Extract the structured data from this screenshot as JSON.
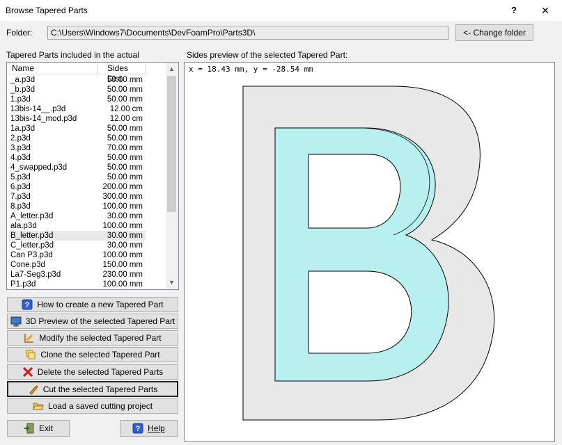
{
  "window": {
    "title": "Browse Tapered Parts",
    "help_glyph": "?",
    "close_glyph": "✕"
  },
  "folder": {
    "label": "Folder:",
    "path": "C:\\Users\\Windows7\\Documents\\DevFoamPro\\Parts3D\\",
    "change_button": "<- Change folder"
  },
  "parts_list": {
    "heading": "Tapered Parts included in the actual",
    "columns": [
      "Name",
      "Sides Dist."
    ],
    "rows": [
      {
        "name": "_a.p3d",
        "dist": "50.00 mm"
      },
      {
        "name": "_b.p3d",
        "dist": "50.00 mm"
      },
      {
        "name": "1.p3d",
        "dist": "50.00 mm"
      },
      {
        "name": "13bis-14__.p3d",
        "dist": "12.00 cm"
      },
      {
        "name": "13bis-14_mod.p3d",
        "dist": "12.00 cm"
      },
      {
        "name": "1a.p3d",
        "dist": "50.00 mm"
      },
      {
        "name": "2.p3d",
        "dist": "50.00 mm"
      },
      {
        "name": "3.p3d",
        "dist": "70.00 mm"
      },
      {
        "name": "4.p3d",
        "dist": "50.00 mm"
      },
      {
        "name": "4_swapped.p3d",
        "dist": "50.00 mm"
      },
      {
        "name": "5.p3d",
        "dist": "50.00 mm"
      },
      {
        "name": "6.p3d",
        "dist": "200.00 mm"
      },
      {
        "name": "7.p3d",
        "dist": "300.00 mm"
      },
      {
        "name": "8.p3d",
        "dist": "100.00 mm"
      },
      {
        "name": "A_letter.p3d",
        "dist": "30.00 mm"
      },
      {
        "name": "ala.p3d",
        "dist": "100.00 mm"
      },
      {
        "name": "B_letter.p3d",
        "dist": "30.00 mm",
        "selected": true
      },
      {
        "name": "C_letter.p3d",
        "dist": "30.00 mm"
      },
      {
        "name": "Can P3.p3d",
        "dist": "100.00 mm"
      },
      {
        "name": "Cone.p3d",
        "dist": "150.00 mm"
      },
      {
        "name": "La7-Seg3.p3d",
        "dist": "230.00 mm"
      },
      {
        "name": "P1.p3d",
        "dist": "100.00 mm"
      }
    ]
  },
  "actions": {
    "how_to_create": "How to create a new Tapered Part",
    "preview_3d": "3D Preview of the selected Tapered Part",
    "modify": "Modify the selected Tapered Part",
    "clone": "Clone the selected Tapered Part",
    "delete": "Delete the selected Tapered Parts",
    "cut": "Cut the selected Tapered Parts",
    "load": "Load a saved cutting project",
    "exit": "Exit",
    "help": "Help"
  },
  "preview": {
    "heading": "Sides preview of the selected Tapered Part:",
    "coords": "x = 18.43 mm, y = -28.54 mm",
    "colors": {
      "outer_fill": "#e8e8e8",
      "inner_fill": "#b8f0f0"
    }
  }
}
